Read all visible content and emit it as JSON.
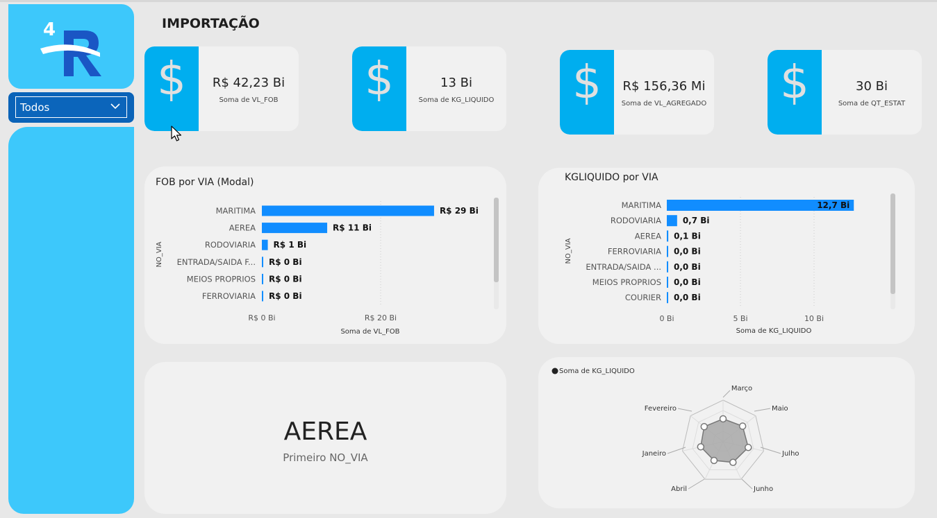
{
  "filter": {
    "selected": "Todos"
  },
  "page_title": "IMPORTAÇÃO",
  "kpis": [
    {
      "icon": "dollar-icon",
      "value": "R$ 42,23 Bi",
      "label": "Soma de VL_FOB"
    },
    {
      "icon": "dollar-icon",
      "value": "13 Bi",
      "label": "Soma de KG_LIQUIDO"
    },
    {
      "icon": "dollar-icon",
      "value": "R$ 156,36 Mi",
      "label": "Soma de VL_AGREGADO"
    },
    {
      "icon": "dollar-icon",
      "value": "30 Bi",
      "label": "Soma de QT_ESTAT"
    }
  ],
  "fob_chart": {
    "title": "FOB por VIA (Modal)",
    "ylabel": "NO_VIA",
    "xlabel": "Soma de VL_FOB",
    "ticks": [
      "R$ 0 Bi",
      "R$ 20 Bi"
    ]
  },
  "kg_chart": {
    "title": "KGLIQUIDO por VIA",
    "ylabel": "NO_VIA",
    "xlabel": "Soma de KG_LIQUIDO",
    "ticks": [
      "0 Bi",
      "5 Bi",
      "10 Bi"
    ]
  },
  "card_first": {
    "value": "AEREA",
    "label": "Primeiro NO_VIA"
  },
  "radar": {
    "legend": "Soma de KG_LIQUIDO"
  },
  "colors": {
    "bar": "#118dff",
    "accent": "#00aeef",
    "panel": "#3dc8fb",
    "dropdown": "#0a63b8"
  },
  "chart_data": [
    {
      "type": "bar",
      "orientation": "horizontal",
      "title": "FOB por VIA (Modal)",
      "xlabel": "Soma de VL_FOB",
      "ylabel": "NO_VIA",
      "categories": [
        "MARITIMA",
        "AEREA",
        "RODOVIARIA",
        "ENTRADA/SAIDA F...",
        "MEIOS PROPRIOS",
        "FERROVIARIA"
      ],
      "values": [
        29,
        11,
        1,
        0,
        0,
        0
      ],
      "data_labels": [
        "R$ 29 Bi",
        "R$ 11 Bi",
        "R$ 1 Bi",
        "R$ 0 Bi",
        "R$ 0 Bi",
        "R$ 0 Bi"
      ],
      "xlim": [
        0,
        35
      ]
    },
    {
      "type": "bar",
      "orientation": "horizontal",
      "title": "KGLIQUIDO por VIA",
      "xlabel": "Soma de KG_LIQUIDO",
      "ylabel": "NO_VIA",
      "categories": [
        "MARITIMA",
        "RODOVIARIA",
        "AEREA",
        "FERROVIARIA",
        "ENTRADA/SAIDA ...",
        "MEIOS PROPRIOS",
        "COURIER"
      ],
      "values": [
        12.7,
        0.7,
        0.1,
        0.0,
        0.0,
        0.0,
        0.0
      ],
      "data_labels": [
        "12,7 Bi",
        "0,7 Bi",
        "0,1 Bi",
        "0,0 Bi",
        "0,0 Bi",
        "0,0 Bi",
        "0,0 Bi"
      ],
      "xlim": [
        0,
        13.5
      ]
    },
    {
      "type": "radar",
      "series": [
        {
          "name": "Soma de KG_LIQUIDO",
          "values": [
            0.55,
            0.6,
            0.62,
            0.55,
            0.5,
            0.55,
            0.58
          ]
        }
      ],
      "categories": [
        "Março",
        "Maio",
        "Julho",
        "Junho",
        "Abril",
        "Janeiro",
        "Fevereiro"
      ]
    }
  ]
}
